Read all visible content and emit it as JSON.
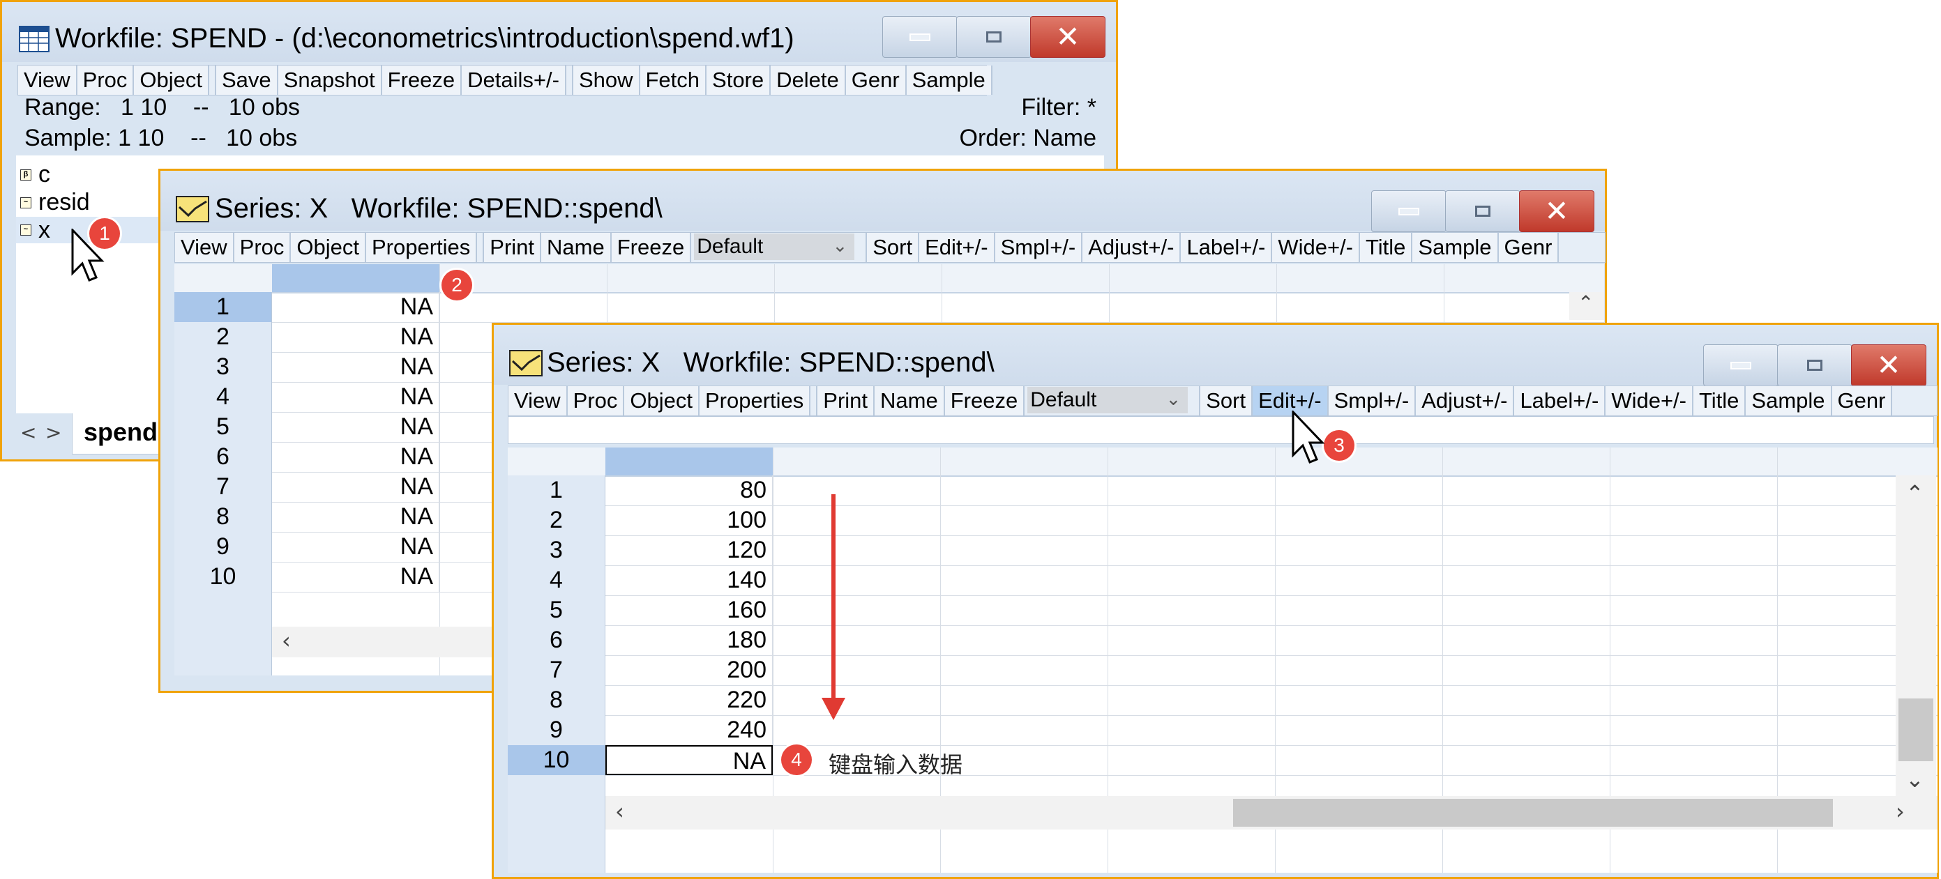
{
  "workfile_window": {
    "title": "Workfile: SPEND - (d:\\econometrics\\introduction\\spend.wf1)",
    "toolbar": [
      "View",
      "Proc",
      "Object",
      "Save",
      "Snapshot",
      "Freeze",
      "Details+/-",
      "Show",
      "Fetch",
      "Store",
      "Delete",
      "Genr",
      "Sample"
    ],
    "range_text": "Range:   1 10    --   10 obs",
    "sample_text": "Sample: 1 10    --   10 obs",
    "filter_text": "Filter: *",
    "order_text": "Order: Name",
    "objects": [
      {
        "name": "c",
        "icon": "coef-icon"
      },
      {
        "name": "resid",
        "icon": "series-icon"
      },
      {
        "name": "x",
        "icon": "series-icon"
      }
    ],
    "tab_label": "spend",
    "tab_nav": [
      "<",
      ">"
    ]
  },
  "series_window_back": {
    "title": "Series: X   Workfile: SPEND::spend\\",
    "toolbar_left": [
      "View",
      "Proc",
      "Object",
      "Properties",
      "Print",
      "Name",
      "Freeze"
    ],
    "dropdown_value": "Default",
    "toolbar_right": [
      "Sort",
      "Edit+/-",
      "Smpl+/-",
      "Adjust+/-",
      "Label+/-",
      "Wide+/-",
      "Title",
      "Sample",
      "Genr"
    ],
    "rows": [
      {
        "obs": "1",
        "value": "NA"
      },
      {
        "obs": "2",
        "value": "NA"
      },
      {
        "obs": "3",
        "value": "NA"
      },
      {
        "obs": "4",
        "value": "NA"
      },
      {
        "obs": "5",
        "value": "NA"
      },
      {
        "obs": "6",
        "value": "NA"
      },
      {
        "obs": "7",
        "value": "NA"
      },
      {
        "obs": "8",
        "value": "NA"
      },
      {
        "obs": "9",
        "value": "NA"
      },
      {
        "obs": "10",
        "value": "NA"
      }
    ]
  },
  "series_window_front": {
    "title": "Series: X   Workfile: SPEND::spend\\",
    "toolbar_left": [
      "View",
      "Proc",
      "Object",
      "Properties",
      "Print",
      "Name",
      "Freeze"
    ],
    "dropdown_value": "Default",
    "toolbar_right": [
      "Sort",
      "Edit+/-",
      "Smpl+/-",
      "Adjust+/-",
      "Label+/-",
      "Wide+/-",
      "Title",
      "Sample",
      "Genr"
    ],
    "highlighted_button": "Edit+/-",
    "rows": [
      {
        "obs": "1",
        "value": "80"
      },
      {
        "obs": "2",
        "value": "100"
      },
      {
        "obs": "3",
        "value": "120"
      },
      {
        "obs": "4",
        "value": "140"
      },
      {
        "obs": "5",
        "value": "160"
      },
      {
        "obs": "6",
        "value": "180"
      },
      {
        "obs": "7",
        "value": "200"
      },
      {
        "obs": "8",
        "value": "220"
      },
      {
        "obs": "9",
        "value": "240"
      },
      {
        "obs": "10",
        "value": "NA"
      }
    ]
  },
  "annotations": {
    "badges": [
      "1",
      "2",
      "3",
      "4"
    ],
    "step4_text": "键盘输入数据",
    "badge_color": "#e8453c",
    "arrow_color": "#e03a32"
  },
  "colors": {
    "window_border": "#f0a30a",
    "chrome": "#d9e5f2",
    "close_button": "#c0392b"
  }
}
